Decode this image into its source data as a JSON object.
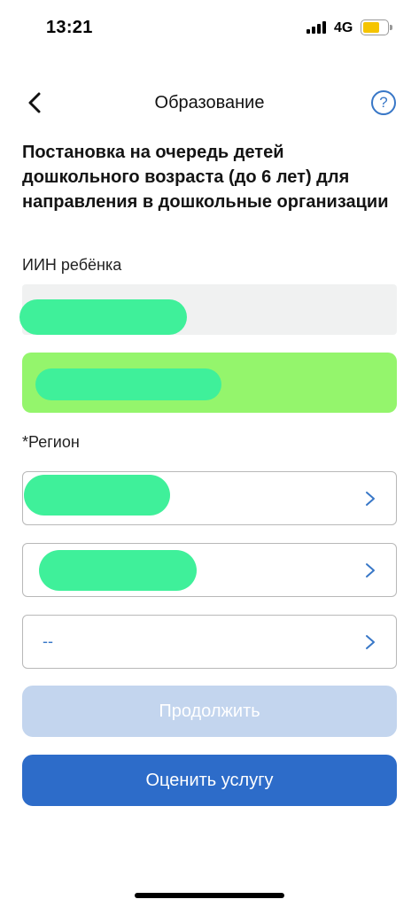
{
  "status_bar": {
    "time": "13:21",
    "network": "4G",
    "icons": [
      "signal-icon",
      "battery-icon"
    ]
  },
  "nav": {
    "title": "Образование",
    "back_icon": "chevron-left-icon",
    "help_label": "?"
  },
  "heading": "Постановка на очередь детей дошкольного возраста (до 6 лет) для направления в дошкольные организации",
  "iin": {
    "label": "ИИН ребёнка"
  },
  "region": {
    "label": "*Регион",
    "selects": [
      {
        "value": ""
      },
      {
        "value": ""
      },
      {
        "value": "--"
      }
    ]
  },
  "buttons": {
    "continue": "Продолжить",
    "rate": "Оценить услугу"
  },
  "colors": {
    "accent": "#2d6cc9",
    "disabled": "#c3d5ee",
    "info_card": "#94f56c",
    "redaction": "#3ff09a"
  }
}
